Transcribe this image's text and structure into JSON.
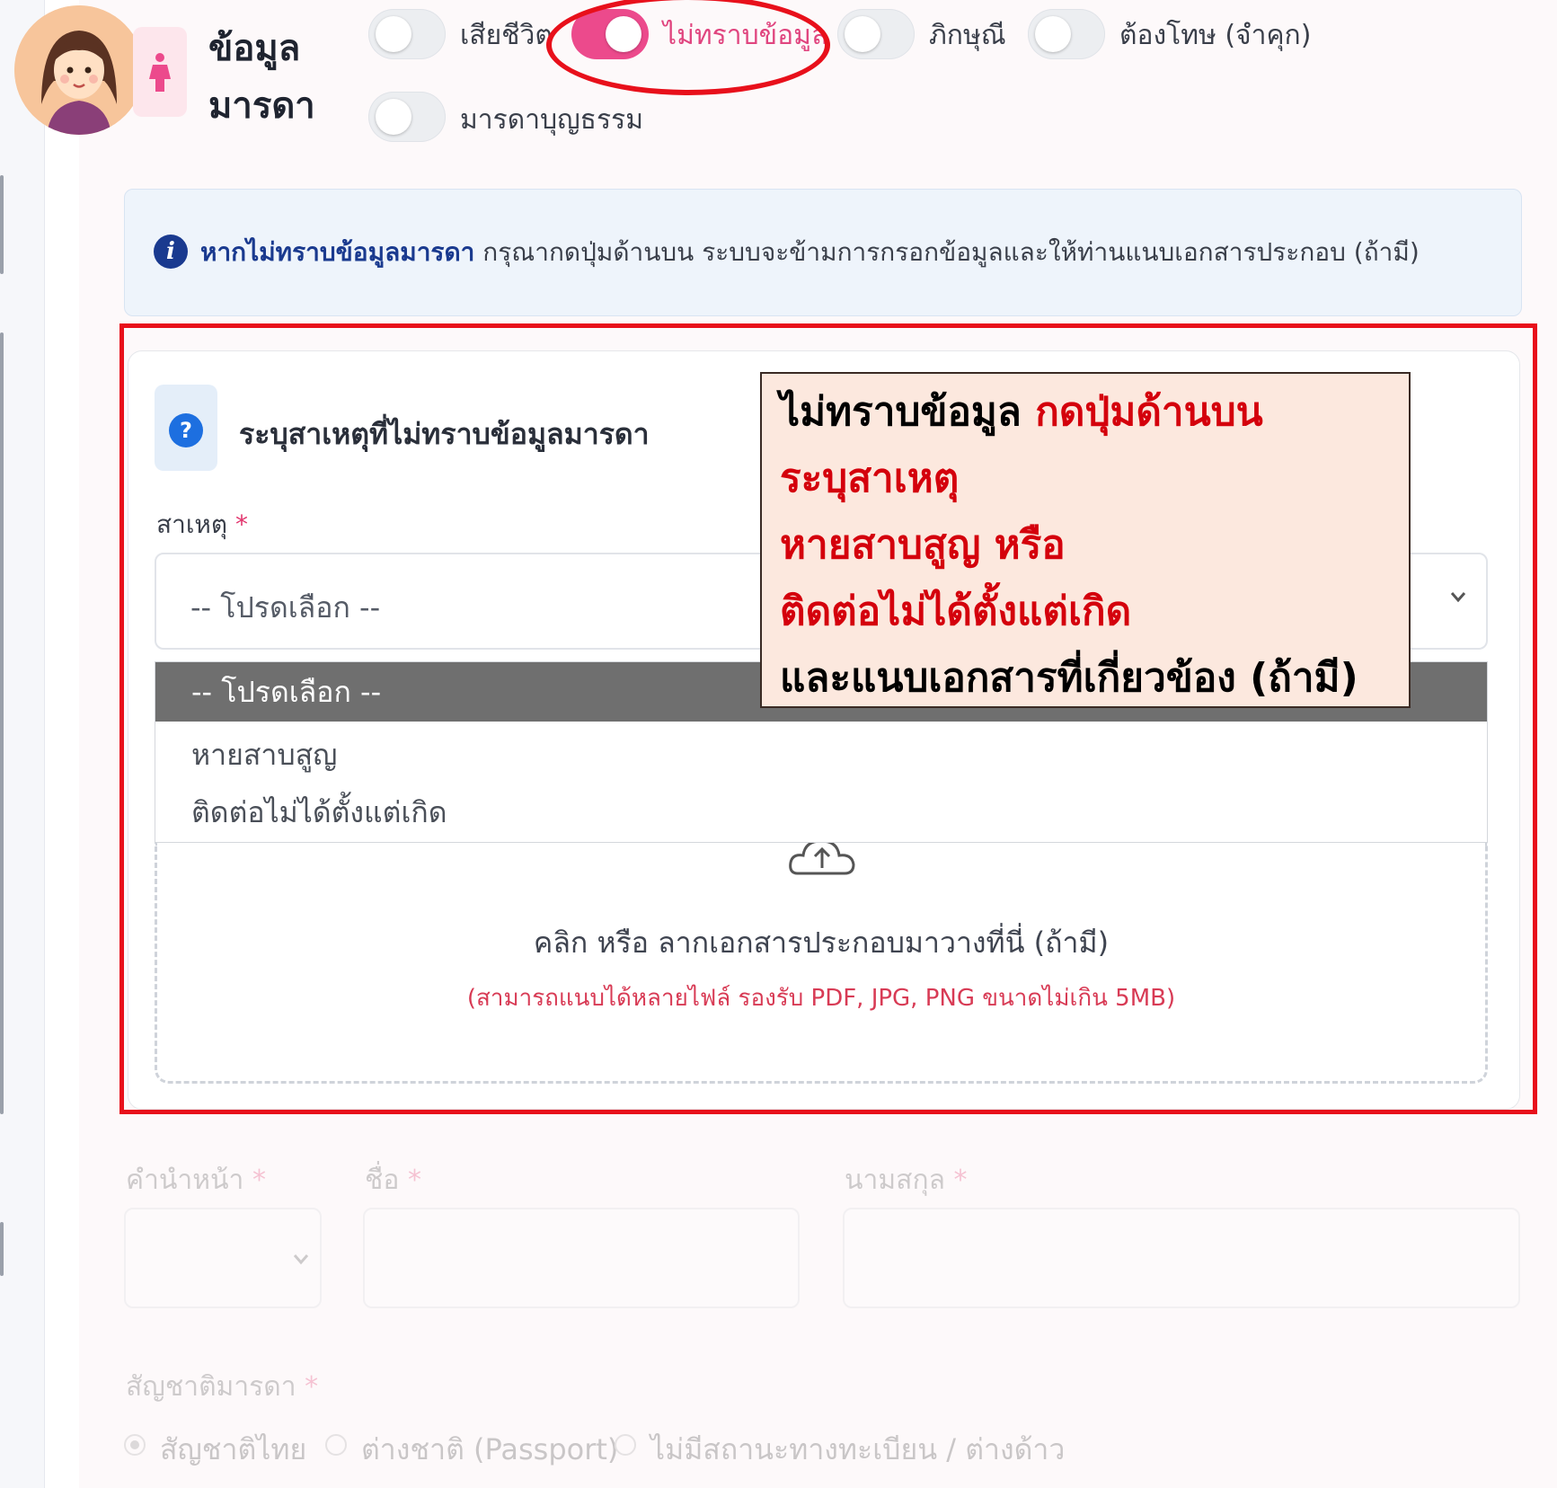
{
  "section": {
    "title_line1": "ข้อมูล",
    "title_line2": "มารดา"
  },
  "status_toggles": [
    {
      "label": "เสียชีวิต",
      "on": false
    },
    {
      "label": "ไม่ทราบข้อมูล",
      "on": true
    },
    {
      "label": "ภิกษุณี",
      "on": false
    },
    {
      "label": "ต้องโทษ (จำคุก)",
      "on": false
    },
    {
      "label": "มารดาบุญธรรม",
      "on": false
    }
  ],
  "info": {
    "bold": "หากไม่ทราบข้อมูลมารดา",
    "text": " กรุณากดปุ่มด้านบน ระบบจะข้ามการกรอกข้อมูลและให้ท่านแนบเอกสารประกอบ (ถ้ามี)"
  },
  "reason_card": {
    "title": "ระบุสาเหตุที่ไม่ทราบข้อมูลมารดา",
    "field_label": "สาเหตุ",
    "required_mark": "*",
    "select_value": "-- โปรดเลือก --",
    "options": [
      "-- โปรดเลือก --",
      "หายสาบสูญ",
      "ติดต่อไม่ได้ตั้งแต่เกิด"
    ]
  },
  "upload": {
    "main": "คลิก หรือ ลากเอกสารประกอบมาวางที่นี่ (ถ้ามี)",
    "sub": "(สามารถแนบได้หลายไฟล์ รองรับ PDF, JPG, PNG ขนาดไม่เกิน 5MB)"
  },
  "annotation": {
    "line1_black": "ไม่ทราบข้อมูล",
    "line1_red": " กดปุ่มด้านบน",
    "line2": "ระบุสาเหตุ",
    "line3": "หายสาบสูญ หรือ",
    "line4": "ติดต่อไม่ได้ตั้งแต่เกิด",
    "line5": "และแนบเอกสารที่เกี่ยวข้อง (ถ้ามี)"
  },
  "name_fields": {
    "prefix_label": "คำนำหน้า",
    "first_label": "ชื่อ",
    "last_label": "นามสกุล",
    "required_mark": "*"
  },
  "nationality": {
    "label": "สัญชาติมารดา",
    "required_mark": "*",
    "options": [
      "สัญชาติไทย",
      "ต่างชาติ (Passport)",
      "ไม่มีสถานะทางทะเบียน / ต่างด้าว"
    ],
    "selected_index": 0
  },
  "colors": {
    "accent_pink": "#ec4a8c",
    "annotation_red": "#e8101b",
    "info_blue": "#1a3a8f"
  }
}
